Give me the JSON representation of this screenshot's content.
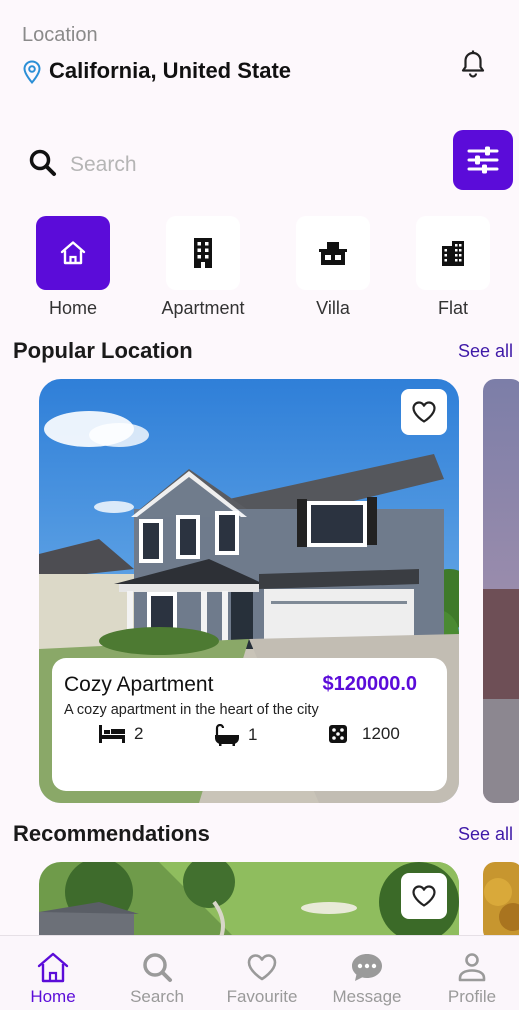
{
  "header": {
    "location_label": "Location",
    "location_value": "California, United State"
  },
  "search": {
    "placeholder": "Search"
  },
  "categories": [
    {
      "label": "Home",
      "icon": "home-icon",
      "active": true
    },
    {
      "label": "Apartment",
      "icon": "building-icon",
      "active": false
    },
    {
      "label": "Villa",
      "icon": "villa-icon",
      "active": false
    },
    {
      "label": "Flat",
      "icon": "flat-icon",
      "active": false
    }
  ],
  "popular": {
    "title": "Popular Location",
    "see_all": "See all",
    "card": {
      "name": "Cozy Apartment",
      "price": "$120000.0",
      "description": "A cozy apartment in the heart of the city",
      "beds": "2",
      "baths": "1",
      "area": "1200"
    }
  },
  "recommendations": {
    "title": "Recommendations",
    "see_all": "See all"
  },
  "nav": [
    {
      "label": "Home",
      "icon": "home-icon",
      "active": true
    },
    {
      "label": "Search",
      "icon": "search-icon",
      "active": false
    },
    {
      "label": "Favourite",
      "icon": "heart-icon",
      "active": false
    },
    {
      "label": "Message",
      "icon": "chat-icon",
      "active": false
    },
    {
      "label": "Profile",
      "icon": "person-icon",
      "active": false
    }
  ],
  "colors": {
    "accent": "#5b0cd9",
    "link": "#3f1aa8",
    "background": "#fdf8fc"
  }
}
